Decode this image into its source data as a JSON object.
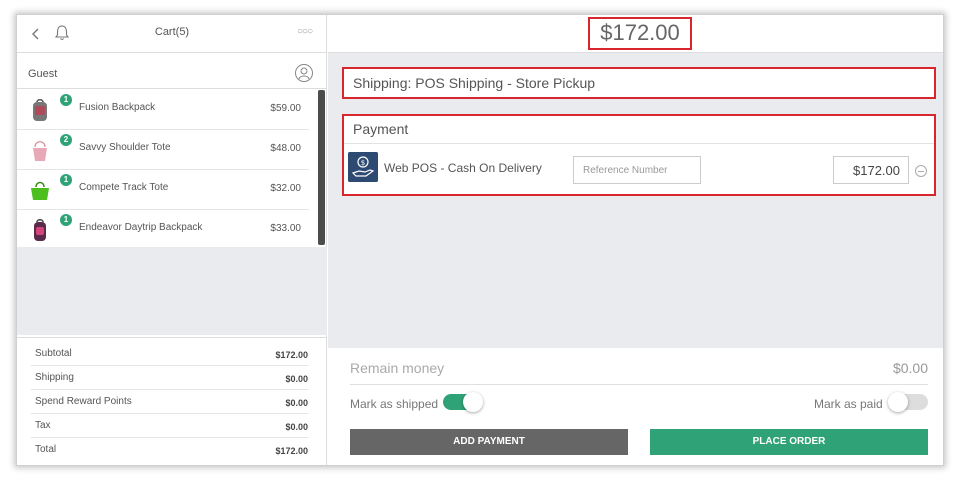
{
  "cart": {
    "title": "Cart(5)",
    "customer": "Guest",
    "items": [
      {
        "qty": "1",
        "name": "Fusion Backpack",
        "price": "$59.00",
        "image": "backpack-gray"
      },
      {
        "qty": "2",
        "name": "Savvy Shoulder Tote",
        "price": "$48.00",
        "image": "tote-pink"
      },
      {
        "qty": "1",
        "name": "Compete Track Tote",
        "price": "$32.00",
        "image": "tote-green"
      },
      {
        "qty": "1",
        "name": "Endeavor Daytrip Backpack",
        "price": "$33.00",
        "image": "backpack-pink"
      }
    ],
    "totals": [
      {
        "label": "Subtotal",
        "value": "$172.00"
      },
      {
        "label": "Shipping",
        "value": "$0.00"
      },
      {
        "label": "Spend Reward Points",
        "value": "$0.00"
      },
      {
        "label": "Tax",
        "value": "$0.00"
      },
      {
        "label": "Total",
        "value": "$172.00"
      }
    ]
  },
  "checkout": {
    "grand_total": "$172.00",
    "shipping": "Shipping: POS Shipping - Store Pickup",
    "payment_title": "Payment",
    "payment_method": "Web POS - Cash On Delivery",
    "reference_placeholder": "Reference Number",
    "payment_amount": "$172.00",
    "remain_label": "Remain money",
    "remain_value": "$0.00",
    "mark_shipped_label": "Mark as shipped",
    "mark_shipped": true,
    "mark_paid_label": "Mark as paid",
    "mark_paid": false,
    "add_payment_label": "ADD PAYMENT",
    "place_order_label": "PLACE ORDER"
  },
  "colors": {
    "accent": "#2fa377",
    "highlight": "#d9262c",
    "panel_gray": "#e9ebef",
    "dark_button": "#666666"
  },
  "icons": [
    "back-icon",
    "bell-icon",
    "more-icon",
    "customer-icon",
    "cash-hand-icon",
    "remove-icon"
  ]
}
